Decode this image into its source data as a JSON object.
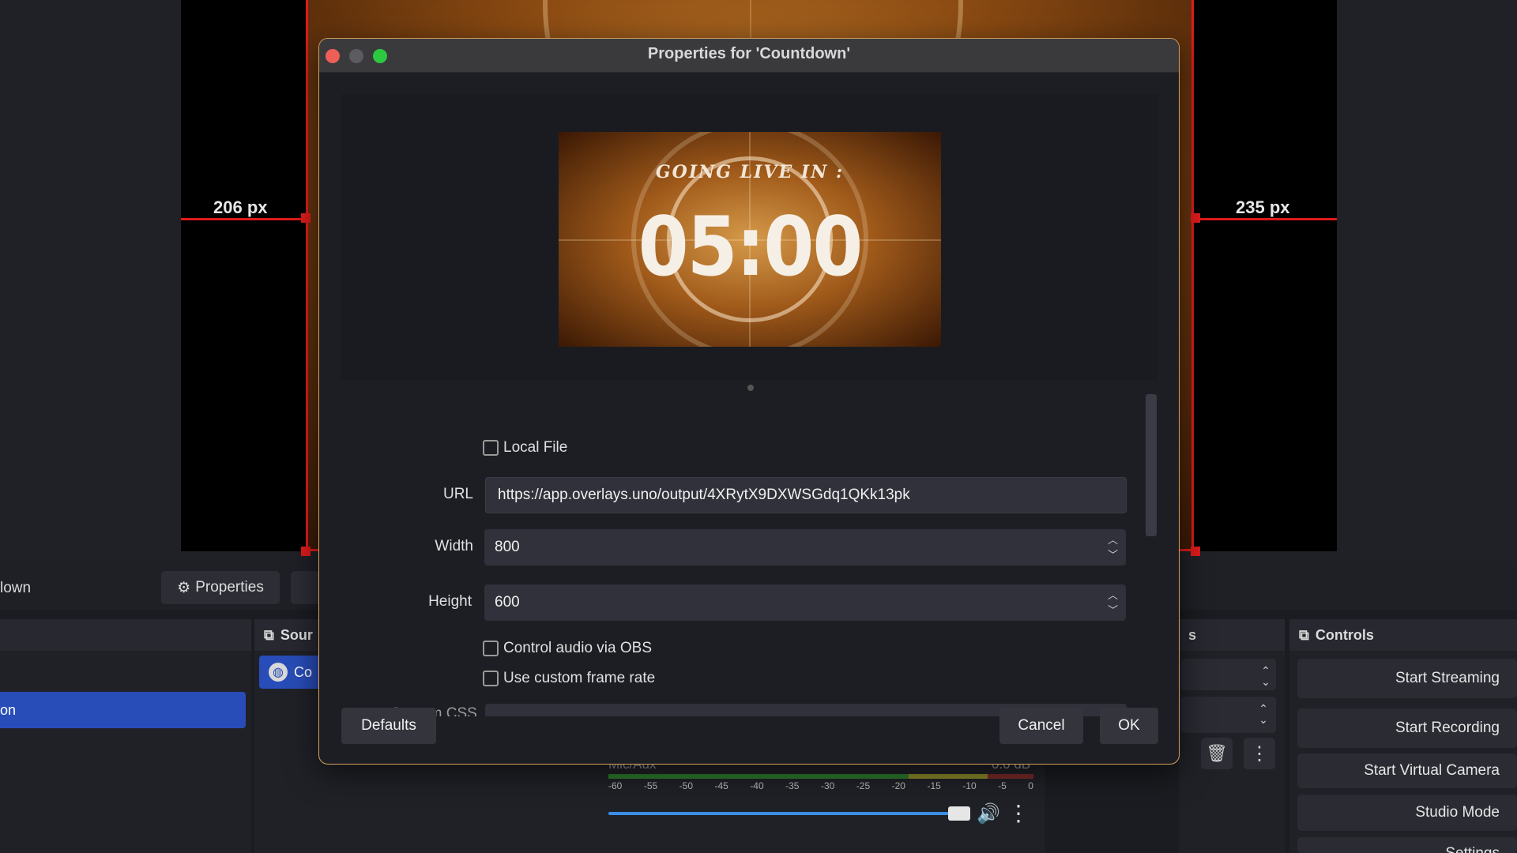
{
  "canvas": {
    "left_guide_label": "206 px",
    "right_guide_label": "235 px"
  },
  "obs": {
    "scene_name_partial": "lown",
    "properties_label": "Properties",
    "scenes_selected_partial": "on",
    "sources_title_partial": "Sour",
    "source_item_partial": "Co",
    "transitions_title_partial": "s",
    "controls_title": "Controls",
    "controls": [
      "Start Streaming",
      "Start Recording",
      "Start Virtual Camera",
      "Studio Mode",
      "Settings"
    ],
    "mixer": {
      "channel_partial": "Mic/Aux",
      "db_partial": "0.0 dB",
      "ticks": [
        "-60",
        "-55",
        "-50",
        "-45",
        "-40",
        "-35",
        "-30",
        "-25",
        "-20",
        "-15",
        "-10",
        "-5",
        "0"
      ]
    }
  },
  "dialog": {
    "title": "Properties for 'Countdown'",
    "preview": {
      "heading": "GOING LIVE IN :",
      "time": "05:00"
    },
    "local_file_label": "Local File",
    "url_label": "URL",
    "url_value": "https://app.overlays.uno/output/4XRytX9DXWSGdq1QKk13pk",
    "width_label": "Width",
    "width_value": "800",
    "height_label": "Height",
    "height_value": "600",
    "control_audio_label": "Control audio via OBS",
    "custom_fps_label": "Use custom frame rate",
    "custom_css_partial": "Custom CSS",
    "defaults_label": "Defaults",
    "cancel_label": "Cancel",
    "ok_label": "OK"
  },
  "colors": {
    "accent_blue": "#284cb8",
    "guide_red": "#e01b1b",
    "dialog_border": "#d4a060"
  }
}
